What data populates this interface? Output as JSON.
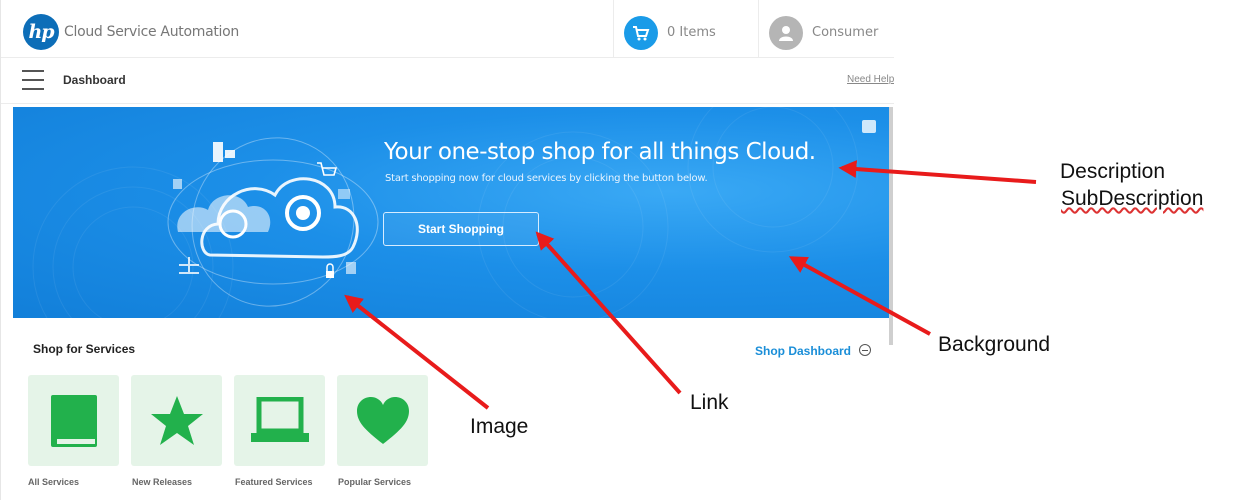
{
  "header": {
    "app_title": "Cloud Service Automation",
    "cart_label": "0 Items",
    "user_label": "Consumer"
  },
  "subheader": {
    "page_title": "Dashboard",
    "help_link": "Need Help"
  },
  "hero": {
    "title": "Your one-stop shop for all things Cloud.",
    "subtitle": "Start shopping now for cloud services by clicking the button below.",
    "button_label": "Start Shopping"
  },
  "shop": {
    "title": "Shop for Services",
    "dashboard_link": "Shop Dashboard",
    "tiles": [
      {
        "label": "All Services",
        "icon": "book-icon"
      },
      {
        "label": "New Releases",
        "icon": "star-icon"
      },
      {
        "label": "Featured Services",
        "icon": "laptop-icon"
      },
      {
        "label": "Popular Services",
        "icon": "heart-icon"
      }
    ]
  },
  "annotations": {
    "description": "Description",
    "subdescription": "SubDescription",
    "background": "Background",
    "link": "Link",
    "image": "Image"
  },
  "colors": {
    "hero_blue": "#1c8fe8",
    "brand_blue": "#0d6eb8",
    "link_blue": "#1a8ed8",
    "tile_green": "#22b14c",
    "tile_bg": "#e5f4e8",
    "arrow_red": "#e81b1b"
  }
}
